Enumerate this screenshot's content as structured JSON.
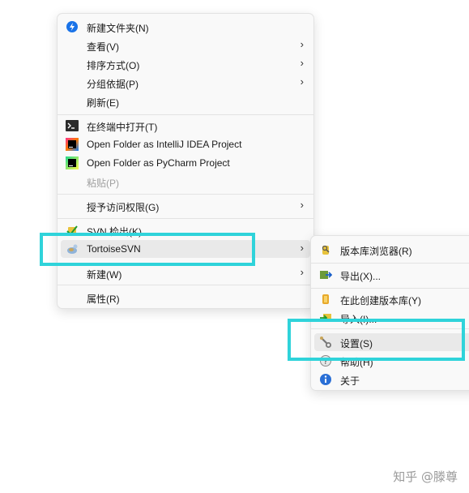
{
  "main_menu": {
    "new_folder": "新建文件夹(N)",
    "view": "查看(V)",
    "sort_by": "排序方式(O)",
    "group_by": "分组依据(P)",
    "refresh": "刷新(E)",
    "open_terminal": "在终端中打开(T)",
    "open_intellij": "Open Folder as IntelliJ IDEA Project",
    "open_pycharm": "Open Folder as PyCharm Project",
    "paste": "粘贴(P)",
    "grant_access": "授予访问权限(G)",
    "svn_checkout": "SVN 检出(K)...",
    "tortoisesvn": "TortoiseSVN",
    "new": "新建(W)",
    "properties": "属性(R)"
  },
  "sub_menu": {
    "repo_browser": "版本库浏览器(R)",
    "export": "导出(X)...",
    "create_repo": "在此创建版本库(Y)",
    "import": "导入(I)...",
    "settings": "设置(S)",
    "help": "帮助(H)",
    "about": "关于"
  },
  "arrow": "›",
  "watermark": "知乎 @滕尊",
  "colors": {
    "highlight": "#2fd3da",
    "menu_bg": "#f9f9f9",
    "hover_bg": "#e9e9e9"
  }
}
